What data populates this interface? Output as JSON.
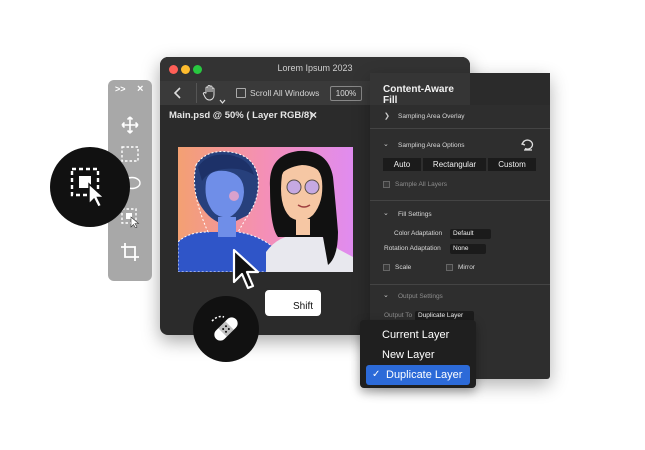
{
  "window": {
    "title": "Lorem Ipsum 2023",
    "scroll_all_windows_label": "Scroll All Windows",
    "zoom": "100%",
    "doc_tab": "Main.psd @ 50% ( Layer RGB/8)",
    "close_glyph": "×",
    "colors": {
      "close": "#ff5f57",
      "min": "#febc2e",
      "max": "#28c840"
    }
  },
  "tools": {
    "header_collapse": ">>",
    "header_close": "×"
  },
  "panel": {
    "title": "Content-Aware Fill",
    "sampling_overlay": "Sampling Area Overlay",
    "sampling_options": "Sampling Area Options",
    "modes": [
      "Auto",
      "Rectangular",
      "Custom"
    ],
    "sample_all_layers": "Sample All Layers",
    "fill_settings": "Fill Settings",
    "color_adaptation_label": "Color Adaptation",
    "color_adaptation_value": "Default",
    "rotation_adaptation_label": "Rotation Adaptation",
    "rotation_adaptation_value": "None",
    "scale": "Scale",
    "mirror": "Mirror",
    "output_settings": "Output Settings",
    "output_to_label": "Output To",
    "output_to_value": "Duplicate Layer"
  },
  "menu": {
    "items": [
      "Current Layer",
      "New Layer",
      "Duplicate Layer"
    ],
    "check": "✓"
  },
  "shift_key": "Shift"
}
